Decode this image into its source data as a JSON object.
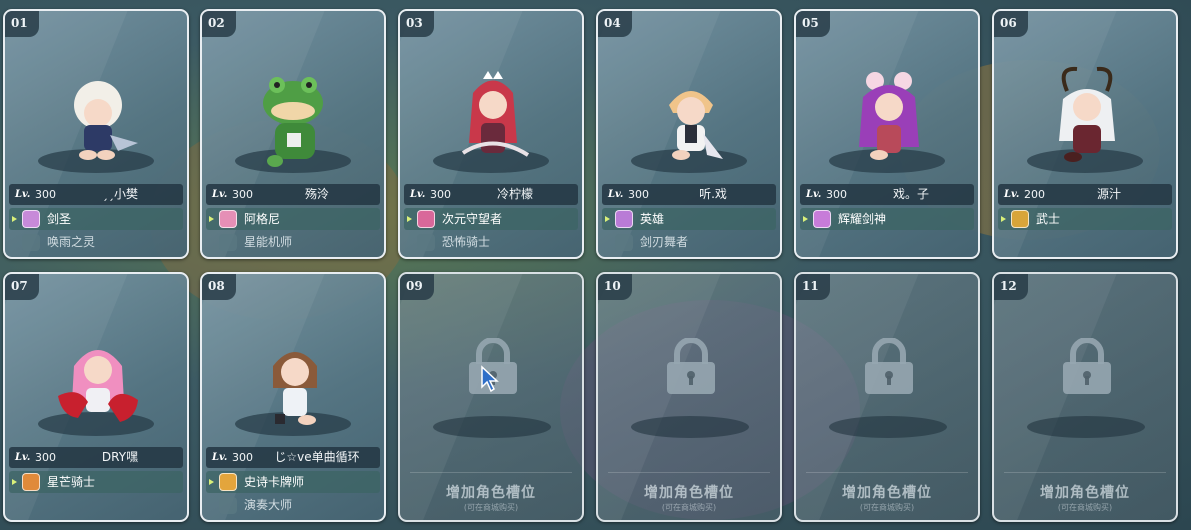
{
  "slots": [
    {
      "num": "01",
      "level_prefix": "Lv.",
      "level": "300",
      "name": "ˏˏ小樊",
      "job": "剑圣",
      "sub_job": "唤雨之灵",
      "icon_color": "#c78ad9"
    },
    {
      "num": "02",
      "level_prefix": "Lv.",
      "level": "300",
      "name": "殇泠",
      "job": "阿格尼",
      "sub_job": "星能机师",
      "icon_color": "#e58fb6"
    },
    {
      "num": "03",
      "level_prefix": "Lv.",
      "level": "300",
      "name": "冷柠檬",
      "job": "次元守望者",
      "sub_job": "恐怖骑士",
      "icon_color": "#d9689a"
    },
    {
      "num": "04",
      "level_prefix": "Lv.",
      "level": "300",
      "name": "听.戏",
      "job": "英雄",
      "sub_job": "剑刃舞者",
      "icon_color": "#b97bd6"
    },
    {
      "num": "05",
      "level_prefix": "Lv.",
      "level": "300",
      "name": "戏。子",
      "job": "辉耀剑神",
      "sub_job": "",
      "icon_color": "#c77cd9"
    },
    {
      "num": "06",
      "level_prefix": "Lv.",
      "level": "200",
      "name": "源汁",
      "job": "武士",
      "sub_job": "",
      "icon_color": "#d8a53a"
    },
    {
      "num": "07",
      "level_prefix": "Lv.",
      "level": "300",
      "name": "DRY嘿",
      "job": "星芒骑士",
      "sub_job": "",
      "icon_color": "#e08a3a"
    },
    {
      "num": "08",
      "level_prefix": "Lv.",
      "level": "300",
      "name": "じ☆ve单曲循环",
      "job": "史诗卡牌师",
      "sub_job": "演奏大师",
      "icon_color": "#e3a53c"
    }
  ],
  "locked_slots": [
    {
      "num": "09",
      "add_label": "增加角色槽位",
      "add_sub": "(可在商城购买)"
    },
    {
      "num": "10",
      "add_label": "增加角色槽位",
      "add_sub": "(可在商城购买)"
    },
    {
      "num": "11",
      "add_label": "增加角色槽位",
      "add_sub": "(可在商城购买)"
    },
    {
      "num": "12",
      "add_label": "增加角色槽位",
      "add_sub": "(可在商城购买)"
    }
  ]
}
